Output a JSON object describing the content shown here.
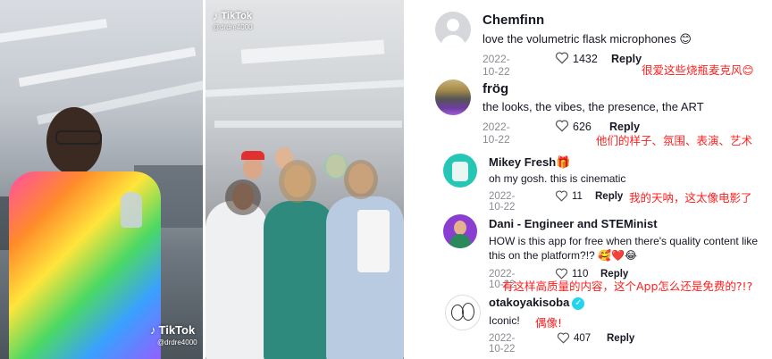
{
  "video_left": {
    "brand": "TikTok",
    "user": "@drdre4000"
  },
  "video_right": {
    "brand": "TikTok",
    "user": "@drdre4000"
  },
  "comments": [
    {
      "username": "Chemfinn",
      "text": "love the volumetric flask microphones",
      "emoji": "😊",
      "date": "2022-10-22",
      "likes": "1432",
      "reply": "Reply",
      "translation": "很爱这些烧瓶麦克风😊",
      "verified": false
    },
    {
      "username": "frög",
      "text": "the looks, the vibes, the presence, the ART",
      "emoji": "",
      "date": "2022-10-22",
      "likes": "626",
      "reply": "Reply",
      "translation": "他们的样子、氛围、表演、艺术",
      "verified": false
    },
    {
      "username": "Mikey Fresh",
      "username_emoji": "🎁",
      "text": "oh my gosh. this is cinematic",
      "emoji": "",
      "date": "2022-10-22",
      "likes": "11",
      "reply": "Reply",
      "translation": "我的天呐，这太像电影了",
      "verified": false
    },
    {
      "username": "Dani - Engineer and STEMinist",
      "text": "HOW is this app for free when there's quality content like",
      "text2": "this on the platform?!?",
      "emoji": "🥰❤️😂",
      "date": "2022-10-22",
      "likes": "110",
      "reply": "Reply",
      "translation": "有这样高质量的内容，这个App怎么还是免费的?!?",
      "verified": false
    },
    {
      "username": "otakoyakisoba",
      "text": "Iconic!",
      "emoji": "",
      "date": "2022-10-22",
      "likes": "407",
      "reply": "Reply",
      "translation": "偶像!",
      "verified": true
    }
  ],
  "colors": {
    "translation": "#ff1e1e",
    "text": "#161823",
    "muted": "#8a8b91",
    "verified": "#20d5ec"
  }
}
